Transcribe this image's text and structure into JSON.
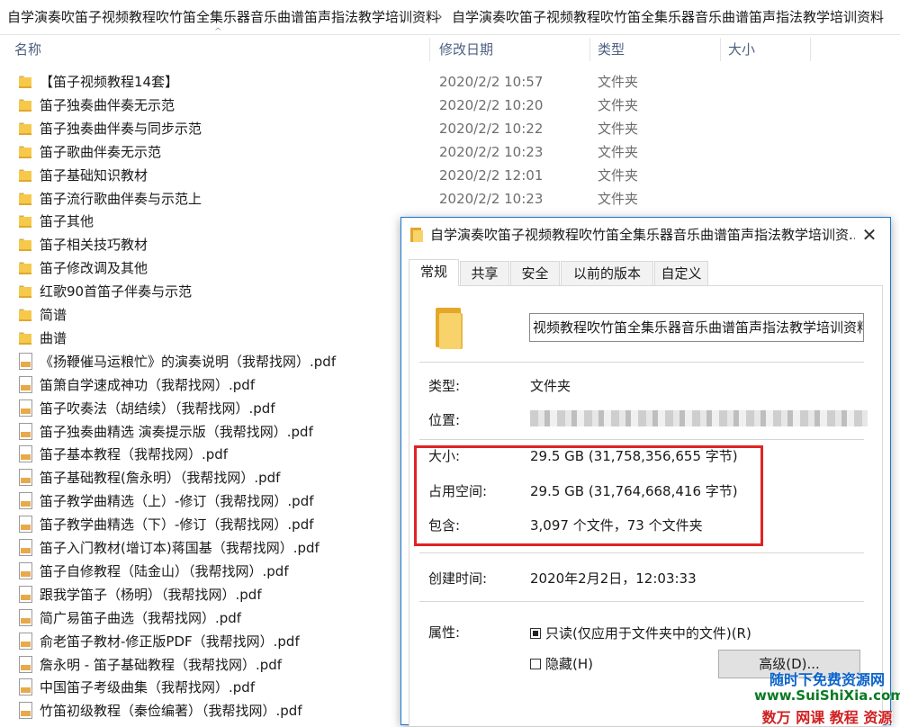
{
  "breadcrumb": {
    "segment1": "自学演奏吹笛子视频教程吹竹笛全集乐器音乐曲谱笛声指法教学培训资料",
    "segment2": "自学演奏吹笛子视频教程吹竹笛全集乐器音乐曲谱笛声指法教学培训资料",
    "separator": "›"
  },
  "columns": {
    "name": "名称",
    "date": "修改日期",
    "type": "类型",
    "size": "大小",
    "sort_indicator": "^"
  },
  "files": [
    {
      "kind": "folder",
      "name": "【笛子视频教程14套】",
      "date": "2020/2/2 10:57",
      "type": "文件夹"
    },
    {
      "kind": "folder",
      "name": "笛子独奏曲伴奏无示范",
      "date": "2020/2/2 10:20",
      "type": "文件夹"
    },
    {
      "kind": "folder",
      "name": "笛子独奏曲伴奏与同步示范",
      "date": "2020/2/2 10:22",
      "type": "文件夹"
    },
    {
      "kind": "folder",
      "name": "笛子歌曲伴奏无示范",
      "date": "2020/2/2 10:23",
      "type": "文件夹"
    },
    {
      "kind": "folder",
      "name": "笛子基础知识教材",
      "date": "2020/2/2 12:01",
      "type": "文件夹"
    },
    {
      "kind": "folder",
      "name": "笛子流行歌曲伴奏与示范上",
      "date": "2020/2/2 10:23",
      "type": "文件夹"
    },
    {
      "kind": "folder",
      "name": "笛子其他",
      "date": "",
      "type": ""
    },
    {
      "kind": "folder",
      "name": "笛子相关技巧教材",
      "date": "",
      "type": ""
    },
    {
      "kind": "folder",
      "name": "笛子修改调及其他",
      "date": "",
      "type": ""
    },
    {
      "kind": "folder",
      "name": "红歌90首笛子伴奏与示范",
      "date": "",
      "type": ""
    },
    {
      "kind": "folder",
      "name": "简谱",
      "date": "",
      "type": ""
    },
    {
      "kind": "folder",
      "name": "曲谱",
      "date": "",
      "type": ""
    },
    {
      "kind": "pdf",
      "name": "《扬鞭催马运粮忙》的演奏说明（我帮找网）.pdf",
      "date": "",
      "type": ""
    },
    {
      "kind": "pdf",
      "name": "笛箫自学速成神功（我帮找网）.pdf",
      "date": "",
      "type": ""
    },
    {
      "kind": "pdf",
      "name": "笛子吹奏法（胡结续）（我帮找网）.pdf",
      "date": "",
      "type": ""
    },
    {
      "kind": "pdf",
      "name": "笛子独奏曲精选 演奏提示版（我帮找网）.pdf",
      "date": "",
      "type": ""
    },
    {
      "kind": "pdf",
      "name": "笛子基本教程（我帮找网）.pdf",
      "date": "",
      "type": ""
    },
    {
      "kind": "pdf",
      "name": "笛子基础教程(詹永明）（我帮找网）.pdf",
      "date": "",
      "type": ""
    },
    {
      "kind": "pdf",
      "name": "笛子教学曲精选（上）-修订（我帮找网）.pdf",
      "date": "",
      "type": ""
    },
    {
      "kind": "pdf",
      "name": "笛子教学曲精选（下）-修订（我帮找网）.pdf",
      "date": "",
      "type": ""
    },
    {
      "kind": "pdf",
      "name": "笛子入门教材(增订本)蒋国基（我帮找网）.pdf",
      "date": "",
      "type": ""
    },
    {
      "kind": "pdf",
      "name": "笛子自修教程（陆金山）（我帮找网）.pdf",
      "date": "",
      "type": ""
    },
    {
      "kind": "pdf",
      "name": "跟我学笛子（杨明）（我帮找网）.pdf",
      "date": "",
      "type": ""
    },
    {
      "kind": "pdf",
      "name": "简广易笛子曲选（我帮找网）.pdf",
      "date": "",
      "type": ""
    },
    {
      "kind": "pdf",
      "name": "俞老笛子教材-修正版PDF（我帮找网）.pdf",
      "date": "",
      "type": ""
    },
    {
      "kind": "pdf",
      "name": "詹永明 - 笛子基础教程（我帮找网）.pdf",
      "date": "",
      "type": ""
    },
    {
      "kind": "pdf",
      "name": "中国笛子考级曲集（我帮找网）.pdf",
      "date": "",
      "type": ""
    },
    {
      "kind": "pdf",
      "name": "竹笛初级教程（秦俭编著）（我帮找网）.pdf",
      "date": "",
      "type": ""
    }
  ],
  "dialog": {
    "title": "自学演奏吹笛子视频教程吹竹笛全集乐器音乐曲谱笛声指法教学培训资...",
    "close": "✕",
    "tabs": [
      "常规",
      "共享",
      "安全",
      "以前的版本",
      "自定义"
    ],
    "active_tab": 0,
    "folder_name": "视频教程吹竹笛全集乐器音乐曲谱笛声指法教学培训资料",
    "type_label": "类型:",
    "type_value": "文件夹",
    "location_label": "位置:",
    "size_label": "大小:",
    "size_value": "29.5 GB (31,758,356,655 字节)",
    "disk_label": "占用空间:",
    "disk_value": "29.5 GB (31,764,668,416 字节)",
    "contains_label": "包含:",
    "contains_value": "3,097 个文件，73 个文件夹",
    "created_label": "创建时间:",
    "created_value": "2020年2月2日，12:03:33",
    "attr_label": "属性:",
    "readonly_label": "只读(仅应用于文件夹中的文件)(R)",
    "readonly_checked": true,
    "hidden_label": "隐藏(H)",
    "hidden_checked": false,
    "advanced_button": "高级(D)..."
  },
  "watermark": {
    "line1": "随时下免费资源网",
    "line2": "www.SuiShiXia.com",
    "line3": "数万 网课 教程 资源"
  },
  "colors": {
    "dialog_border": "#1a78d4",
    "highlight_box": "#e02424",
    "column_header_text": "#4d6082"
  }
}
